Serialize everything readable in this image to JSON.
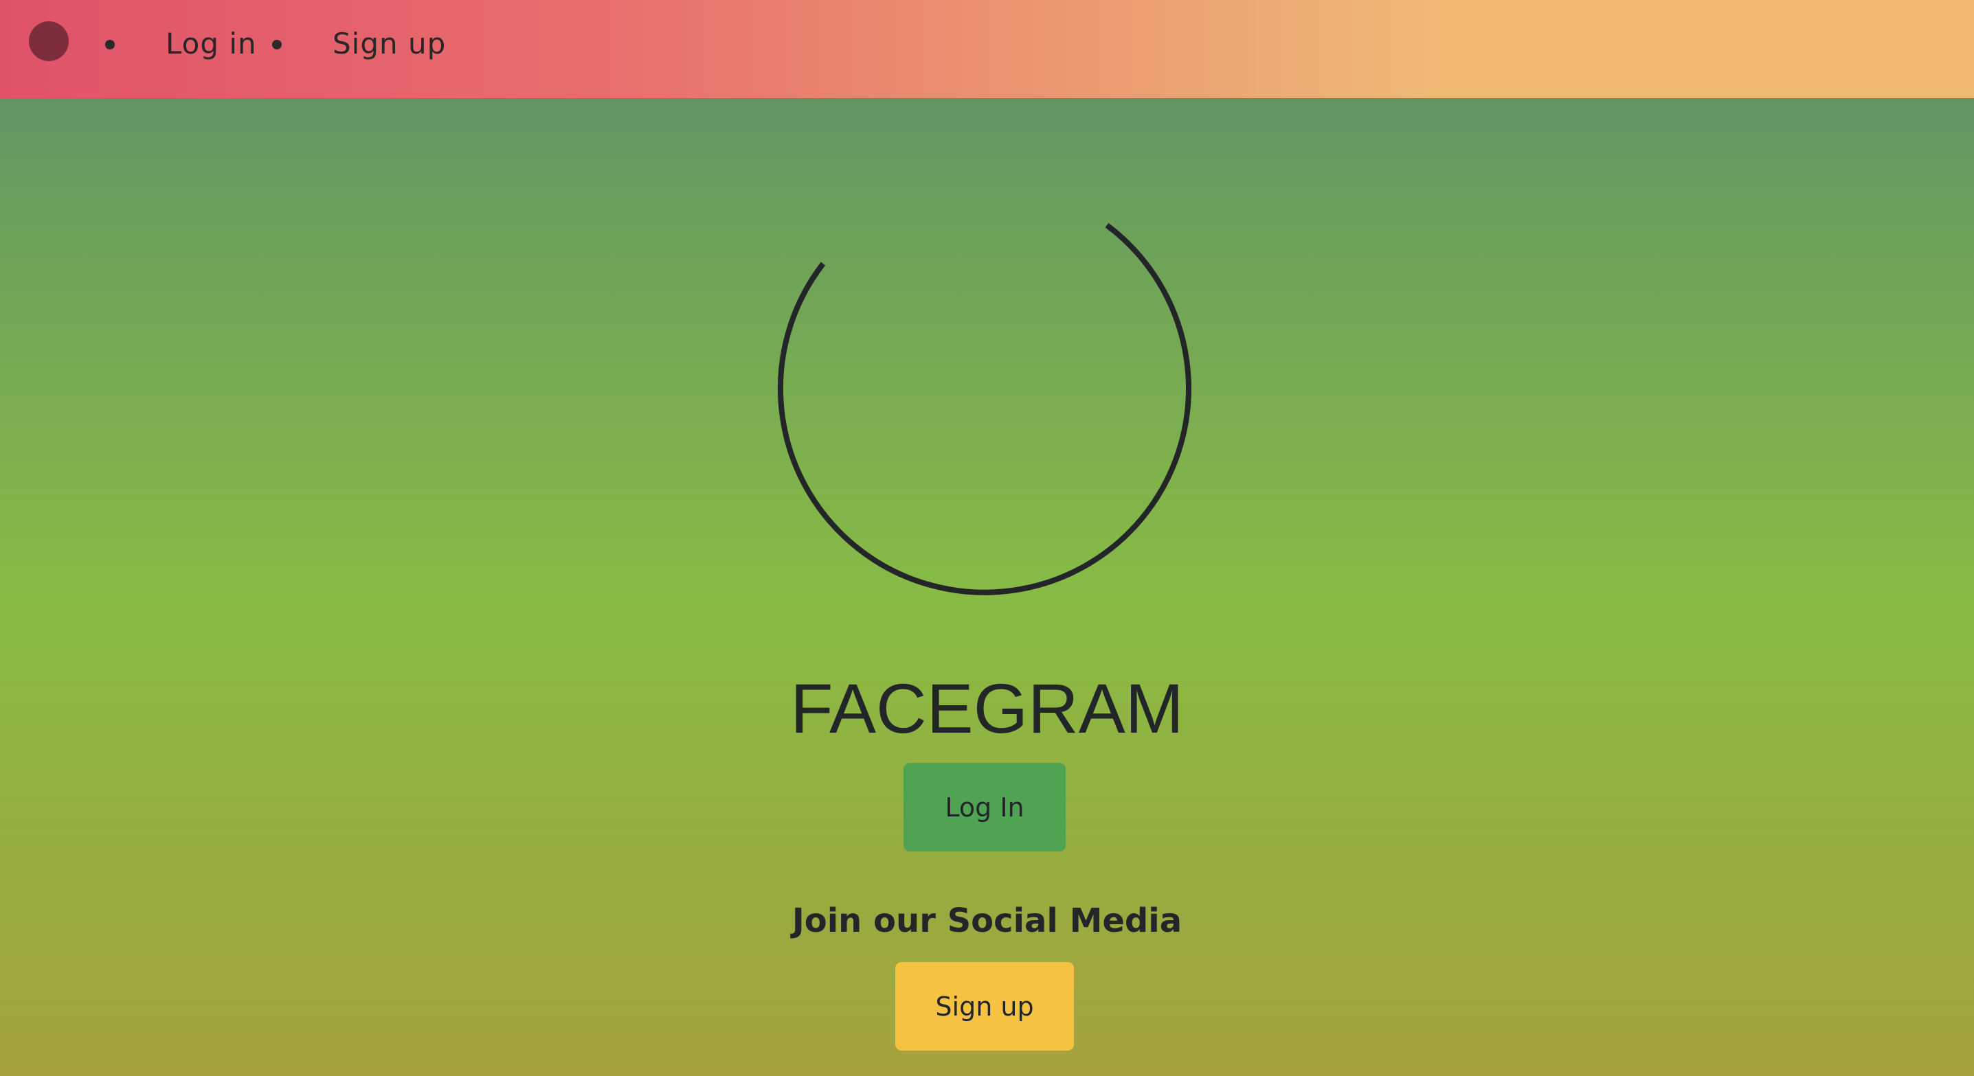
{
  "navbar": {
    "login_label": "Log in",
    "signup_label": "Sign up",
    "background_from": "#e0526a",
    "background_to": "#efb974"
  },
  "hero": {
    "icon": "loading-spinner-icon",
    "title": "FACEGRAM",
    "login_button": "Log In",
    "tagline": "Join our Social Media",
    "signup_button": "Sign up"
  },
  "colors": {
    "login_button": "#50a353",
    "signup_button": "#f6c241",
    "text": "#222629"
  }
}
